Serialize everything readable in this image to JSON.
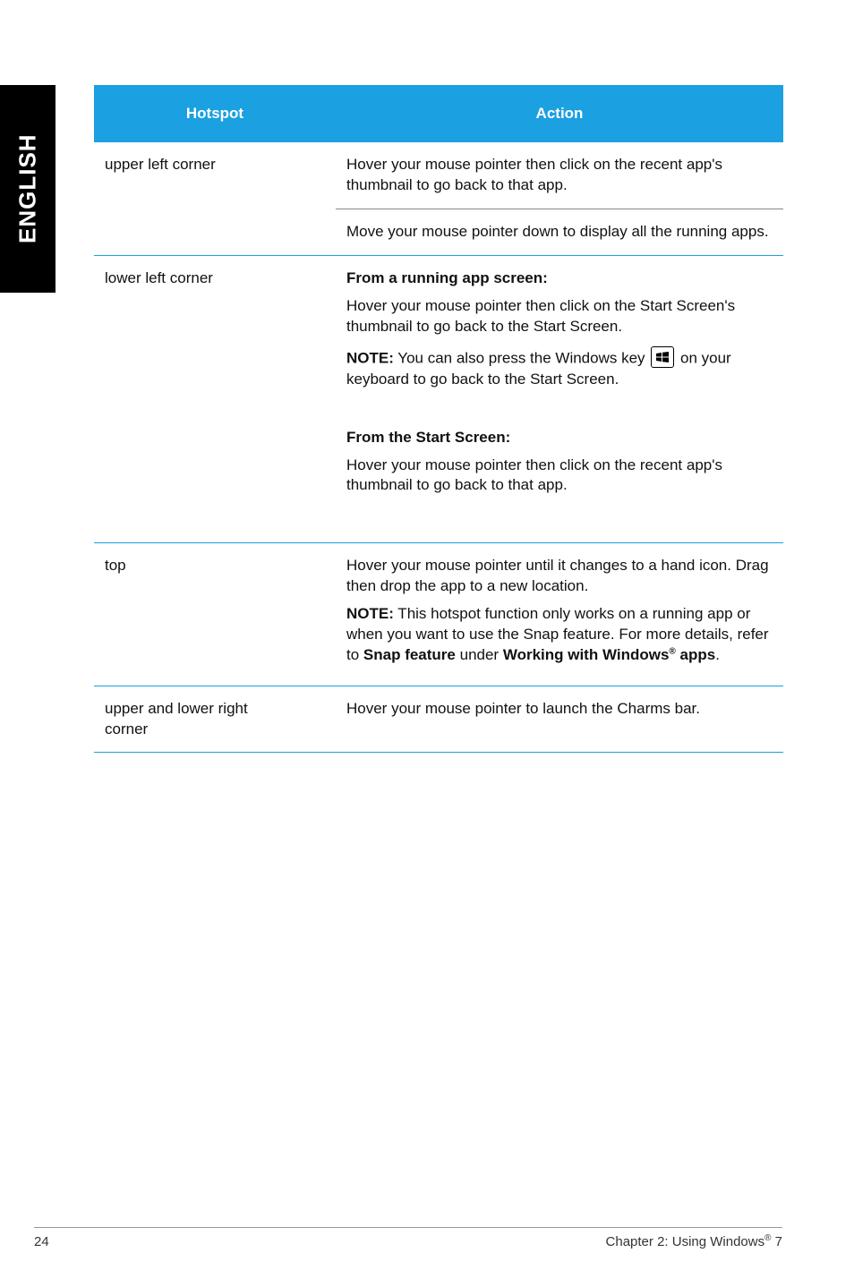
{
  "sidebar": {
    "language": "ENGLISH"
  },
  "table": {
    "headers": {
      "hotspot": "Hotspot",
      "action": "Action"
    },
    "rows": {
      "upper_left": {
        "hotspot": "upper left corner",
        "action1": "Hover your mouse pointer then click on the recent app's thumbnail to go back to that app.",
        "action2": "Move your mouse pointer down to display all the running apps."
      },
      "lower_left": {
        "hotspot": "lower left corner",
        "heading1": "From a running app screen:",
        "para1": "Hover your mouse pointer then click on the Start Screen's thumbnail to go back to the Start Screen.",
        "note_label": "NOTE:",
        "note_pre": "  You can also press the Windows key ",
        "note_post": " on your keyboard to go back to the Start Screen.",
        "heading2": "From the Start Screen:",
        "para2": "Hover your mouse pointer then click on the recent app's thumbnail to go back to that app."
      },
      "top": {
        "hotspot": "top",
        "para1": "Hover your mouse pointer until it changes to a hand icon. Drag then drop the app to a new location.",
        "note_label": "NOTE:",
        "note_pre": "  This hotspot function only works on a running app or when you want to use the Snap feature. For more details, refer to ",
        "note_bold1": "Snap feature",
        "note_mid": " under ",
        "note_bold2": "Working with Windows",
        "note_sup": "®",
        "note_bold3": " apps",
        "note_post": "."
      },
      "upper_lower_right": {
        "hotspot_line1": "upper and lower right",
        "hotspot_line2": "corner",
        "action": "Hover your mouse pointer to launch the Charms bar."
      }
    }
  },
  "footer": {
    "page": "24",
    "chapter_pre": "Chapter 2: Using Windows",
    "chapter_sup": "®",
    "chapter_post": " 7"
  }
}
